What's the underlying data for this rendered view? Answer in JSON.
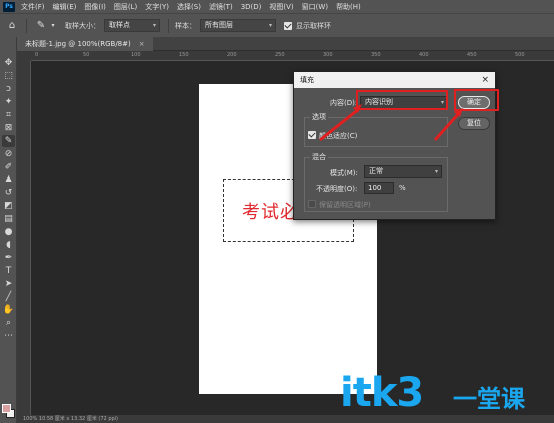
{
  "menubar": {
    "logo": "Ps",
    "items": [
      "文件(F)",
      "编辑(E)",
      "图像(I)",
      "图层(L)",
      "文字(Y)",
      "选择(S)",
      "滤镜(T)",
      "3D(D)",
      "视图(V)",
      "窗口(W)",
      "帮助(H)"
    ]
  },
  "options": {
    "sample_size_label": "取样大小：",
    "sample_size_value": "取样点",
    "sample_label": "样本：",
    "sample_value": "所有图层",
    "show_ring_label": "显示取样环"
  },
  "document": {
    "tab_title": "未标题-1.jpg @ 100%(RGB/8#)",
    "tab_close": "×",
    "canvas_text": "考试必",
    "status": "100%    10.58 厘米 x 13.32 厘米 (72 ppi)"
  },
  "ruler": {
    "ticks": [
      "0",
      "50",
      "100",
      "150",
      "200",
      "250",
      "300",
      "350",
      "400",
      "450",
      "500"
    ]
  },
  "dialog": {
    "title": "填充",
    "close": "×",
    "content_label": "内容(D):",
    "content_value": "内容识别",
    "ok_label": "确定",
    "reset_label": "复位",
    "options_group": "选项",
    "color_adapt_label": "颜色适应(C)",
    "blend_group": "混合",
    "mode_label": "模式(M):",
    "mode_value": "正常",
    "opacity_label": "不透明度(O):",
    "opacity_value": "100",
    "opacity_unit": "%",
    "preserve_label": "保留透明区域(P)"
  },
  "watermark": {
    "latin": "itk3",
    "chinese": "一堂课"
  },
  "colors": {
    "highlight": "#e02020",
    "canvas_text": "#e0282e",
    "watermark": "#1aa7f0"
  }
}
